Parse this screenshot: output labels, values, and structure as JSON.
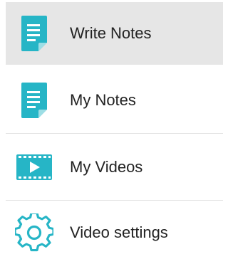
{
  "menu": {
    "items": [
      {
        "label": "Write Notes",
        "icon": "note-document-icon",
        "selected": true
      },
      {
        "label": "My Notes",
        "icon": "note-document-icon",
        "selected": false
      },
      {
        "label": "My Videos",
        "icon": "video-filmstrip-icon",
        "selected": false
      },
      {
        "label": "Video settings",
        "icon": "gear-icon",
        "selected": false
      }
    ]
  },
  "colors": {
    "accent": "#26b5c6",
    "selected_background": "#e6e6e6",
    "text": "#222222",
    "divider": "#e3e3e3"
  }
}
